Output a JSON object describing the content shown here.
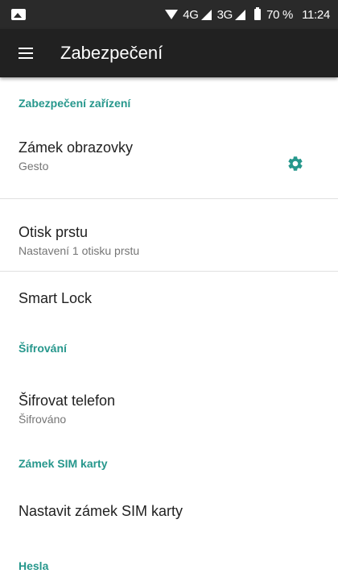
{
  "status_bar": {
    "network_4g": "4G",
    "network_3g": "3G",
    "battery_percent": "70 %",
    "time": "11:24"
  },
  "app_bar": {
    "title": "Zabezpečení"
  },
  "sections": {
    "device_security": {
      "header": "Zabezpečení zařízení",
      "screen_lock": {
        "title": "Zámek obrazovky",
        "subtitle": "Gesto"
      },
      "fingerprint": {
        "title": "Otisk prstu",
        "subtitle": "Nastavení 1 otisku prstu"
      },
      "smart_lock": {
        "title": "Smart Lock"
      }
    },
    "encryption": {
      "header": "Šifrování",
      "encrypt_phone": {
        "title": "Šifrovat telefon",
        "subtitle": "Šifrováno"
      }
    },
    "sim_lock": {
      "header": "Zámek SIM karty",
      "set_sim_lock": {
        "title": "Nastavit zámek SIM karty"
      }
    },
    "passwords": {
      "header": "Hesla"
    }
  },
  "colors": {
    "accent": "#26978c",
    "app_bar": "#212121",
    "status_bar": "#2a2a2a"
  }
}
